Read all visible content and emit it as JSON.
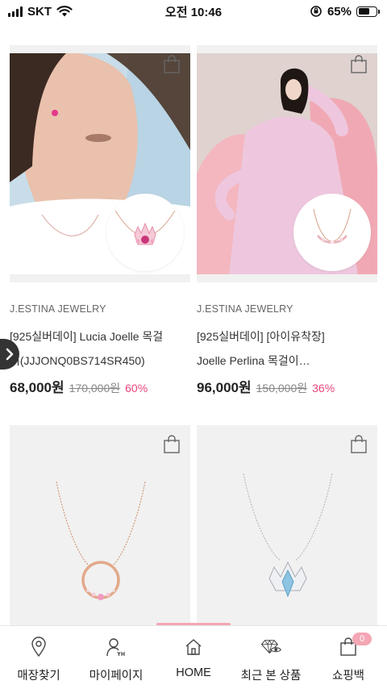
{
  "status_bar": {
    "carrier": "SKT",
    "time": "오전 10:46",
    "battery_percent": "65%",
    "battery_level": 0.65
  },
  "products": [
    {
      "brand": "J.ESTINA JEWELRY",
      "name_line1": "[925실버데이] Lucia Joelle 목걸",
      "name_line2": "이(JJJONQ0BS714SR450)",
      "price": "68,000원",
      "original_price": "170,000원",
      "discount": "60%"
    },
    {
      "brand": "J.ESTINA JEWELRY",
      "name_line1": "[925실버데이] [아이유착장]",
      "name_line2": "Joelle Perlina 목걸이…",
      "price": "96,000원",
      "original_price": "150,000원",
      "discount": "36%"
    },
    {},
    {}
  ],
  "bottom_nav": [
    {
      "label": "매장찾기",
      "icon": "location-pin-icon"
    },
    {
      "label": "마이페이지",
      "icon": "person-my-icon"
    },
    {
      "label": "HOME",
      "icon": "home-icon"
    },
    {
      "label": "최근 본 상품",
      "icon": "recent-view-eye-icon"
    },
    {
      "label": "쇼핑백",
      "icon": "shopping-bag-icon",
      "badge": "0"
    }
  ],
  "colors": {
    "discount": "#e8467c",
    "accent_pink": "#f4a6b4"
  }
}
